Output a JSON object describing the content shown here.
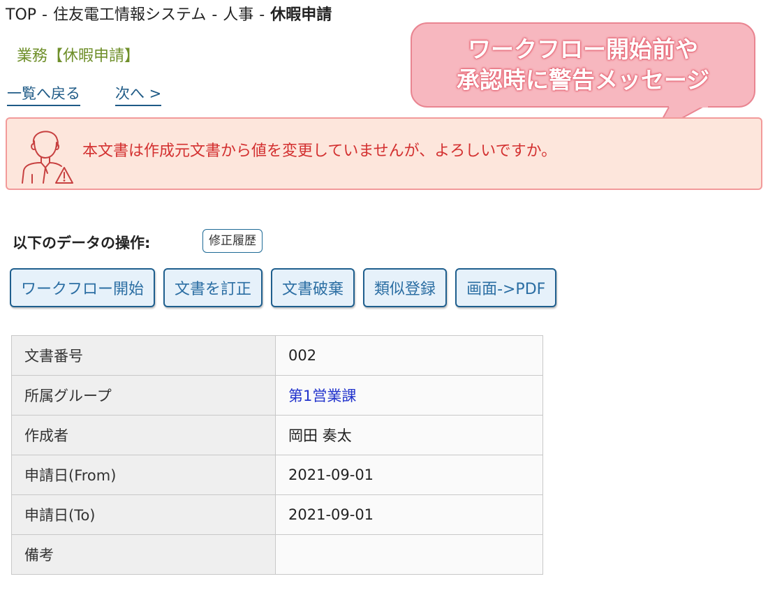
{
  "breadcrumb": {
    "items": [
      "TOP",
      "住友電工情報システム",
      "人事"
    ],
    "current": "休暇申請",
    "separator": "-"
  },
  "category": "業務【休暇申請】",
  "nav": {
    "back": "一覧へ戻る",
    "next": "次へ >"
  },
  "callout": {
    "line1": "ワークフロー開始前や",
    "line2": "承認時に警告メッセージ"
  },
  "alert": {
    "message": "本文書は作成元文書から値を変更していませんが、よろしいですか。"
  },
  "operations": {
    "label": "以下のデータの操作:",
    "history_button": "修正履歴",
    "buttons": [
      "ワークフロー開始",
      "文書を訂正",
      "文書破棄",
      "類似登録",
      "画面->PDF"
    ]
  },
  "details": {
    "rows": [
      {
        "label": "文書番号",
        "value": "002"
      },
      {
        "label": "所属グループ",
        "value": "第1営業課"
      },
      {
        "label": "作成者",
        "value": "岡田 奏太"
      },
      {
        "label": "申請日(From)",
        "value": "2021-09-01"
      },
      {
        "label": "申請日(To)",
        "value": "2021-09-01"
      },
      {
        "label": "備考",
        "value": ""
      }
    ]
  },
  "colors": {
    "alert_text": "#d33030",
    "callout_fill": "#f7b7bf",
    "button_border": "#1f5f8e",
    "link": "#2233cc"
  }
}
